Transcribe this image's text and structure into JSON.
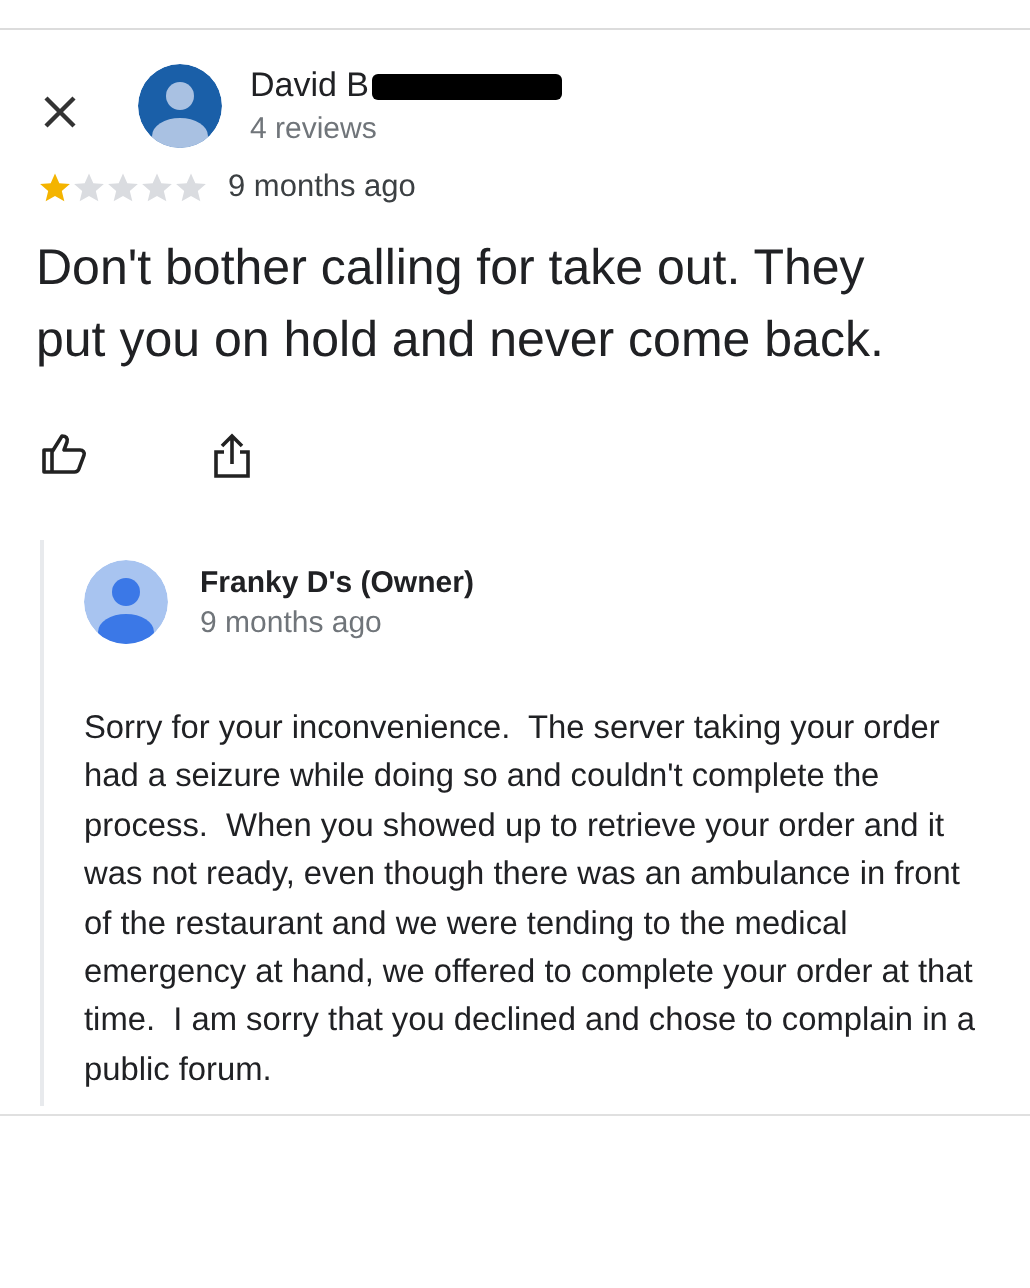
{
  "reviewer": {
    "name": "David B",
    "redacted": true,
    "reviews": "4 reviews"
  },
  "rating": {
    "stars": 1,
    "time": "9 months ago"
  },
  "review_text": "Don't bother calling for take out. They put you on hold and never come back.",
  "reply": {
    "name": "Franky D's (Owner)",
    "time": "9 months ago",
    "text": "Sorry for your inconvenience.  The server taking your order had a seizure while doing so and couldn't complete the process.  When you showed up to retrieve your order and it was not ready, even though there was an ambulance in front of the restaurant and we were tending to the medical emergency at hand, we offered to complete your order at that time.  I am sorry that you declined and chose to complain in a public forum."
  }
}
